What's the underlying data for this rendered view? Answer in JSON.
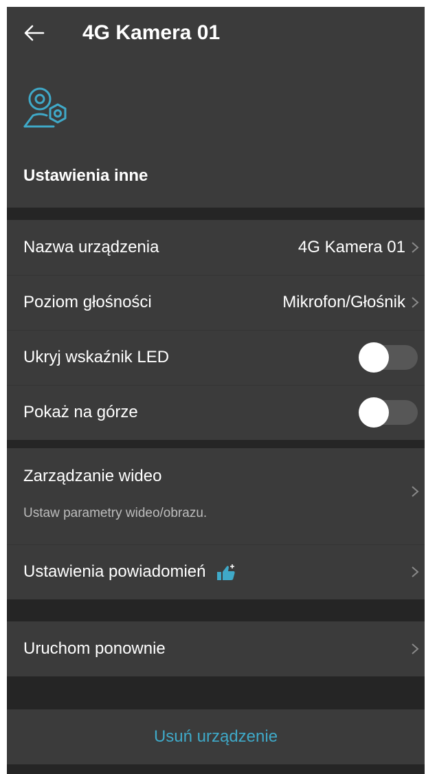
{
  "header": {
    "title": "4G Kamera 01",
    "back_icon": "arrow-left-icon",
    "device_icon": "camera-settings-icon",
    "section_title": "Ustawienia inne"
  },
  "settings": {
    "device_name": {
      "label": "Nazwa urządzenia",
      "value": "4G Kamera 01"
    },
    "volume": {
      "label": "Poziom głośności",
      "value": "Mikrofon/Głośnik"
    },
    "hide_led": {
      "label": "Ukryj wskaźnik LED",
      "enabled": false
    },
    "show_on_top": {
      "label": "Pokaż na górze",
      "enabled": false
    }
  },
  "video": {
    "label": "Zarządzanie wideo",
    "subtitle": "Ustaw parametry wideo/obrazu."
  },
  "notifications": {
    "label": "Ustawienia powiadomień",
    "badge_icon": "thumbs-up-icon"
  },
  "restart": {
    "label": "Uruchom ponownie"
  },
  "delete_label": "Usuń urządzenie",
  "colors": {
    "accent": "#3fa9c8",
    "background": "#252525",
    "panel": "#3b3b3b",
    "toggle_off": "#575757"
  }
}
